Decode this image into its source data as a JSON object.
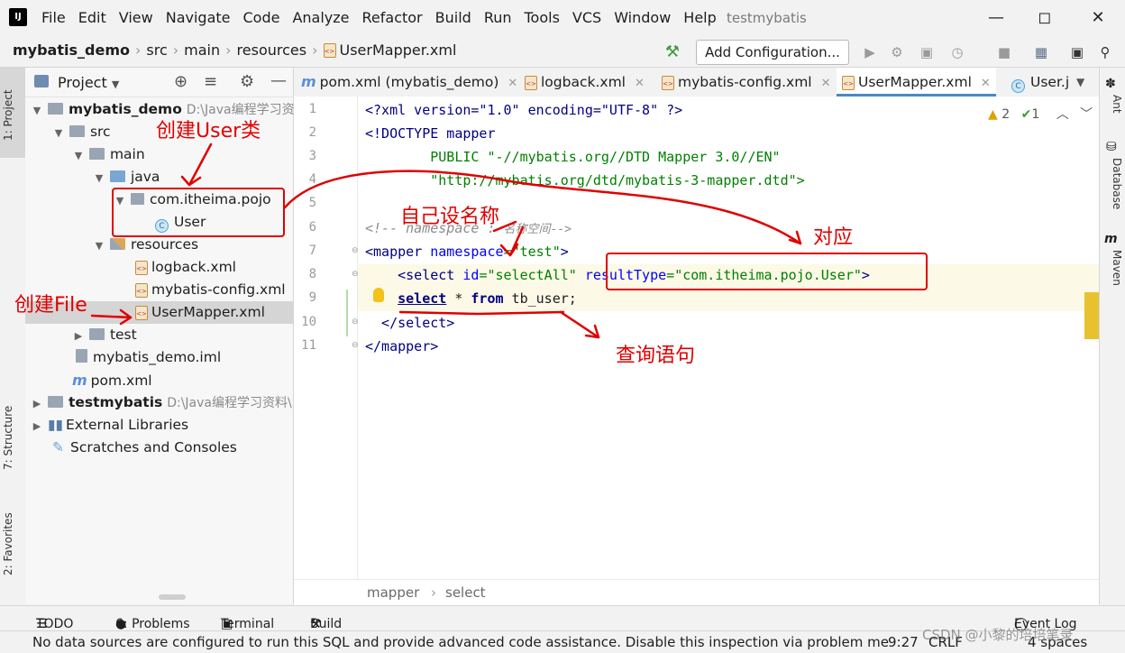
{
  "app": {
    "title": "testmybatis",
    "logo": "IJ"
  },
  "menu": [
    "File",
    "Edit",
    "View",
    "Navigate",
    "Code",
    "Analyze",
    "Refactor",
    "Build",
    "Run",
    "Tools",
    "VCS",
    "Window",
    "Help"
  ],
  "breadcrumb": [
    "mybatis_demo",
    "src",
    "main",
    "resources",
    "UserMapper.xml"
  ],
  "toolbar": {
    "add_config": "Add Configuration..."
  },
  "left_tabs": [
    "1: Project",
    "7: Structure",
    "2: Favorites"
  ],
  "right_tabs": [
    "Ant",
    "Database",
    "Maven"
  ],
  "project_panel": {
    "title": "Project",
    "tree": [
      {
        "label": "mybatis_demo",
        "extra": "D:\\Java编程学习资",
        "bold": true
      },
      {
        "label": "src"
      },
      {
        "label": "main"
      },
      {
        "label": "java"
      },
      {
        "label": "com.itheima.pojo"
      },
      {
        "label": "User"
      },
      {
        "label": "resources"
      },
      {
        "label": "logback.xml"
      },
      {
        "label": "mybatis-config.xml"
      },
      {
        "label": "UserMapper.xml"
      },
      {
        "label": "test"
      },
      {
        "label": "mybatis_demo.iml"
      },
      {
        "label": "pom.xml"
      },
      {
        "label": "testmybatis",
        "extra": "D:\\Java编程学习资料\\",
        "bold": true
      },
      {
        "label": "External Libraries"
      },
      {
        "label": "Scratches and Consoles"
      }
    ]
  },
  "tabs": [
    "pom.xml (mybatis_demo)",
    "logback.xml",
    "mybatis-config.xml",
    "UserMapper.xml",
    "User.j"
  ],
  "editor": {
    "line_numbers": [
      "1",
      "2",
      "3",
      "4",
      "5",
      "6",
      "7",
      "8",
      "9",
      "10",
      "11"
    ],
    "warnings": "2",
    "checks": "1",
    "breadcrumb": [
      "mapper",
      "select"
    ]
  },
  "code": {
    "l1": "<?xml version=\"1.0\" encoding=\"UTF-8\" ?>",
    "l2": "<!DOCTYPE mapper",
    "l3": "        PUBLIC \"-//mybatis.org//DTD Mapper 3.0//EN\"",
    "l4": "        \"http://mybatis.org/dtd/mybatis-3-mapper.dtd\">",
    "l6_a": "<!-- namespace : ",
    "l6_b": "名称空间-->",
    "l7_open": "<mapper ",
    "l7_attr": "namespace",
    "l7_eq": "=",
    "l7_val": "\"test\"",
    "l7_close": ">",
    "l8_indent": "    ",
    "l8_open": "<select ",
    "l8_attr1": "id",
    "l8_eq1": "=",
    "l8_val1": "\"selectAll\"",
    "l8_sp": " ",
    "l8_attr2": "resultType",
    "l8_eq2": "=",
    "l8_val2": "\"com.itheima.pojo.User\"",
    "l8_close": ">",
    "l9_indent": "    ",
    "l9_kw1": "select",
    "l9_mid": " * ",
    "l9_kw2": "from",
    "l9_rest": " tb_user;",
    "l10": "  </select>",
    "l11": "</mapper>"
  },
  "toolwindows": [
    "TODO",
    "6: Problems",
    "Terminal",
    "Build",
    "Event Log"
  ],
  "status": {
    "message": "No data sources are configured to run this SQL and provide advanced code assistance. Disable this inspection via problem me",
    "position": "9:27",
    "line_sep": "CRLF",
    "indent": "4 spaces"
  },
  "watermark": "CSDN @小黎的培培笔录",
  "annotations": {
    "create_user_class": "创建User类",
    "create_file": "创建File",
    "self_name": "自己设名称",
    "correspond": "对应",
    "query_statement": "查询语句"
  },
  "colors": {
    "annotation": "#e00000",
    "accent": "#4a88c7",
    "highlight": "#fcf9e6"
  }
}
